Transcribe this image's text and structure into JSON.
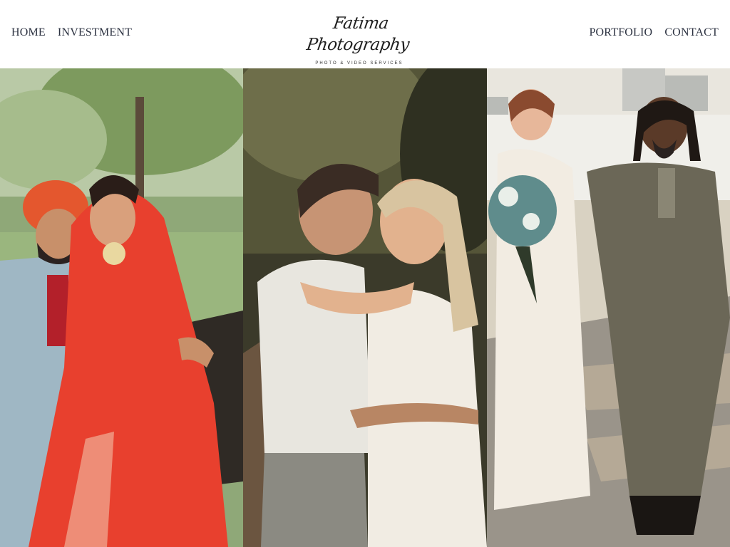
{
  "nav": {
    "left": [
      {
        "label": "HOME"
      },
      {
        "label": "INVESTMENT"
      }
    ],
    "right": [
      {
        "label": "PORTFOLIO"
      },
      {
        "label": "CONTACT"
      }
    ]
  },
  "logo": {
    "name": "Fatima Photography",
    "tagline": "Photo & Video Services"
  },
  "gallery": {
    "photos": [
      {
        "subject": "couple-in-traditional-attire-on-bench"
      },
      {
        "subject": "couple-embracing-outdoors"
      },
      {
        "subject": "couple-walking-on-waterfront"
      }
    ]
  },
  "colors": {
    "nav_text": "#2b3140",
    "background": "#ffffff"
  }
}
